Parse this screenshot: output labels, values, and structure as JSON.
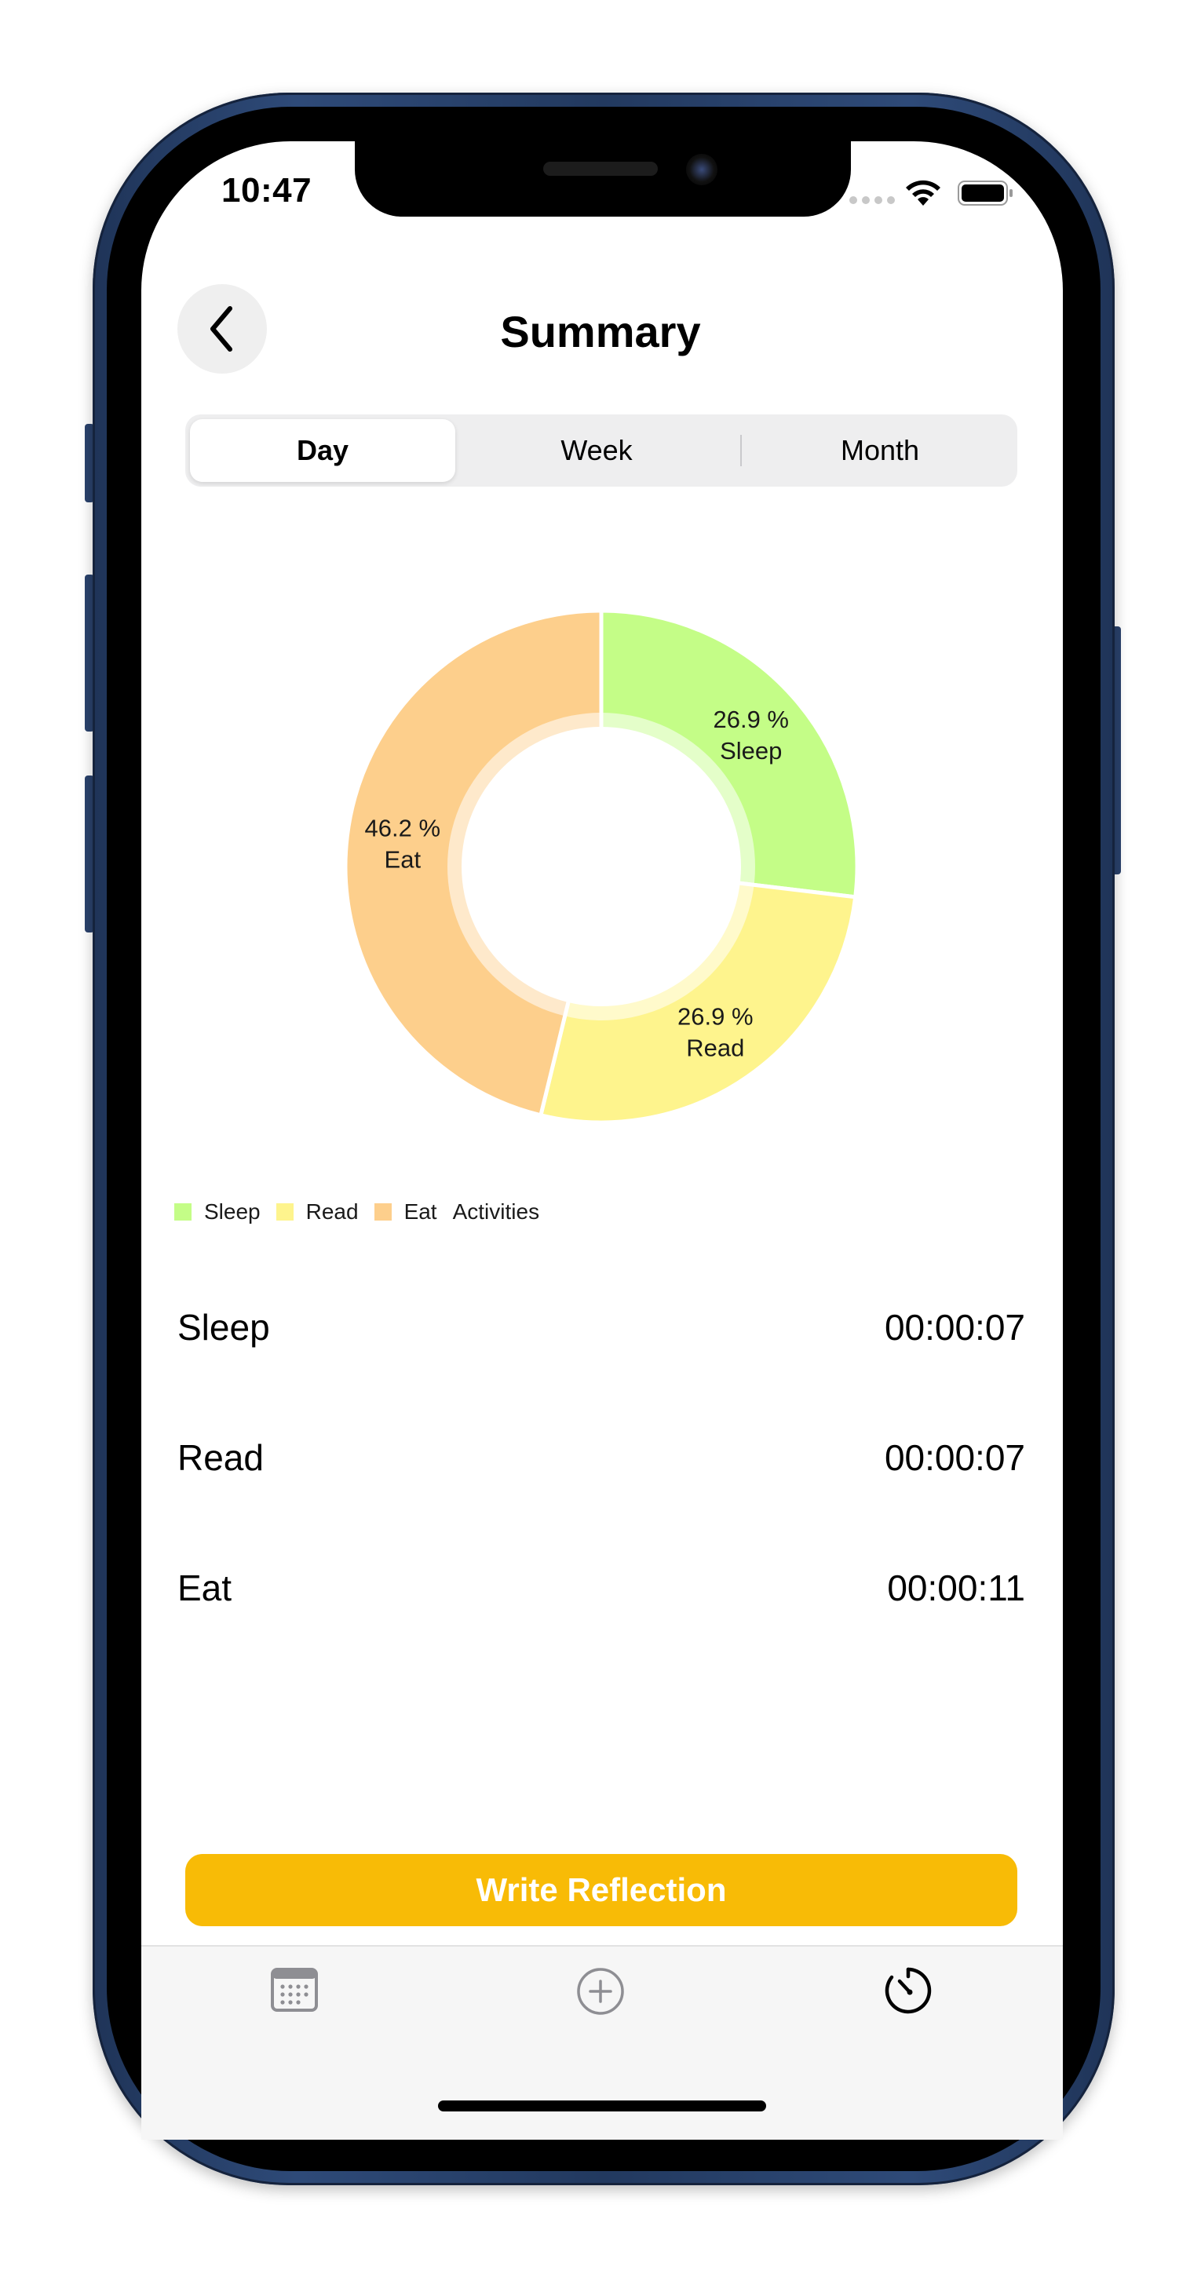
{
  "status_bar": {
    "time": "10:47"
  },
  "header": {
    "back_icon": "chevron-left-icon",
    "title": "Summary"
  },
  "period_selector": {
    "options": [
      "Day",
      "Week",
      "Month"
    ],
    "selected": "Day"
  },
  "chart_data": {
    "type": "pie",
    "style": "donut",
    "slices": [
      {
        "label": "Sleep",
        "percent": 26.9,
        "color": "#c4fd87",
        "display": "26.9 %"
      },
      {
        "label": "Read",
        "percent": 26.9,
        "color": "#fef48d",
        "display": "26.9 %"
      },
      {
        "label": "Eat",
        "percent": 46.2,
        "color": "#fdcf8c",
        "display": "46.2 %"
      }
    ],
    "legend": {
      "entries": [
        "Sleep",
        "Read",
        "Eat"
      ],
      "title": "Activities",
      "placement": "bottom-left"
    }
  },
  "activities": [
    {
      "name": "Sleep",
      "duration": "00:00:07"
    },
    {
      "name": "Read",
      "duration": "00:00:07"
    },
    {
      "name": "Eat",
      "duration": "00:00:11"
    }
  ],
  "action_button": {
    "label": "Write Reflection",
    "color": "#f8bb06"
  },
  "tab_bar": {
    "items": [
      {
        "icon": "calendar-icon"
      },
      {
        "icon": "plus-circle-icon"
      },
      {
        "icon": "timer-icon"
      }
    ]
  }
}
